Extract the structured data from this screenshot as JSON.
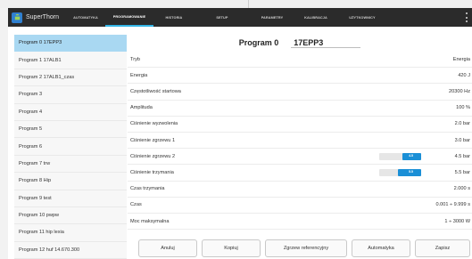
{
  "app": {
    "name": "SuperThorn"
  },
  "tabs": [
    {
      "label": "AUTOMATYKA",
      "active": false
    },
    {
      "label": "PROGRAMOWANIE",
      "active": true
    },
    {
      "label": "HISTORIA",
      "active": false
    },
    {
      "label": "SETUP",
      "active": false
    },
    {
      "label": "PARAMETRY",
      "active": false
    },
    {
      "label": "KALIBRACJA",
      "active": false
    },
    {
      "label": "UŻYTKOWNICY",
      "active": false
    }
  ],
  "programs": [
    "Program 0  17EPP3",
    "Program 1  17ALB1",
    "Program 2  17ALB1_czas",
    "Program 3",
    "Program 4",
    "Program 5",
    "Program 6",
    "Program 7  trw",
    "Program 8  Hip",
    "Program 9  test",
    "Program 10  pwpw",
    "Program 11  hip lexia",
    "Program 12  huf 14.670.300"
  ],
  "selected_program": {
    "label": "Program 0",
    "name": "17EPP3"
  },
  "params": [
    {
      "label": "Tryb",
      "value": "Energia"
    },
    {
      "label": "Energia",
      "value": "420  J"
    },
    {
      "label": "Częstotliwość startowa",
      "value": "20300  Hz"
    },
    {
      "label": "Amplituda",
      "value": "100  %"
    },
    {
      "label": "Ciśnienie wyzwolenia",
      "value": "2.0  bar"
    },
    {
      "label": "Ciśnienie zgrzewu 1",
      "value": "3.0  bar"
    },
    {
      "label": "Ciśnienie zgrzewu 2",
      "value": "4.5  bar",
      "bar": {
        "fraction": 0.45,
        "text": "4.5"
      }
    },
    {
      "label": "Ciśnienie trzymania",
      "value": "5.5  bar",
      "bar": {
        "fraction": 0.55,
        "text": "5.5"
      }
    },
    {
      "label": "Czas trzymania",
      "value": "2.000  s"
    },
    {
      "label": "Czas",
      "value": "0.001 ÷ 9.999  s"
    },
    {
      "label": "Moc maksymalna",
      "value": "1 ÷ 3000  W"
    }
  ],
  "buttons": {
    "cancel": "Anuluj",
    "copy": "Kopiuj",
    "reference": "Zgrzew referencyjny",
    "automation": "Automatyka",
    "save": "Zapisz"
  },
  "colors": {
    "topbar": "#2b2b2b",
    "accent": "#33b5e5",
    "selection": "#a9d8f2",
    "bar_fill": "#1a8fd6"
  }
}
